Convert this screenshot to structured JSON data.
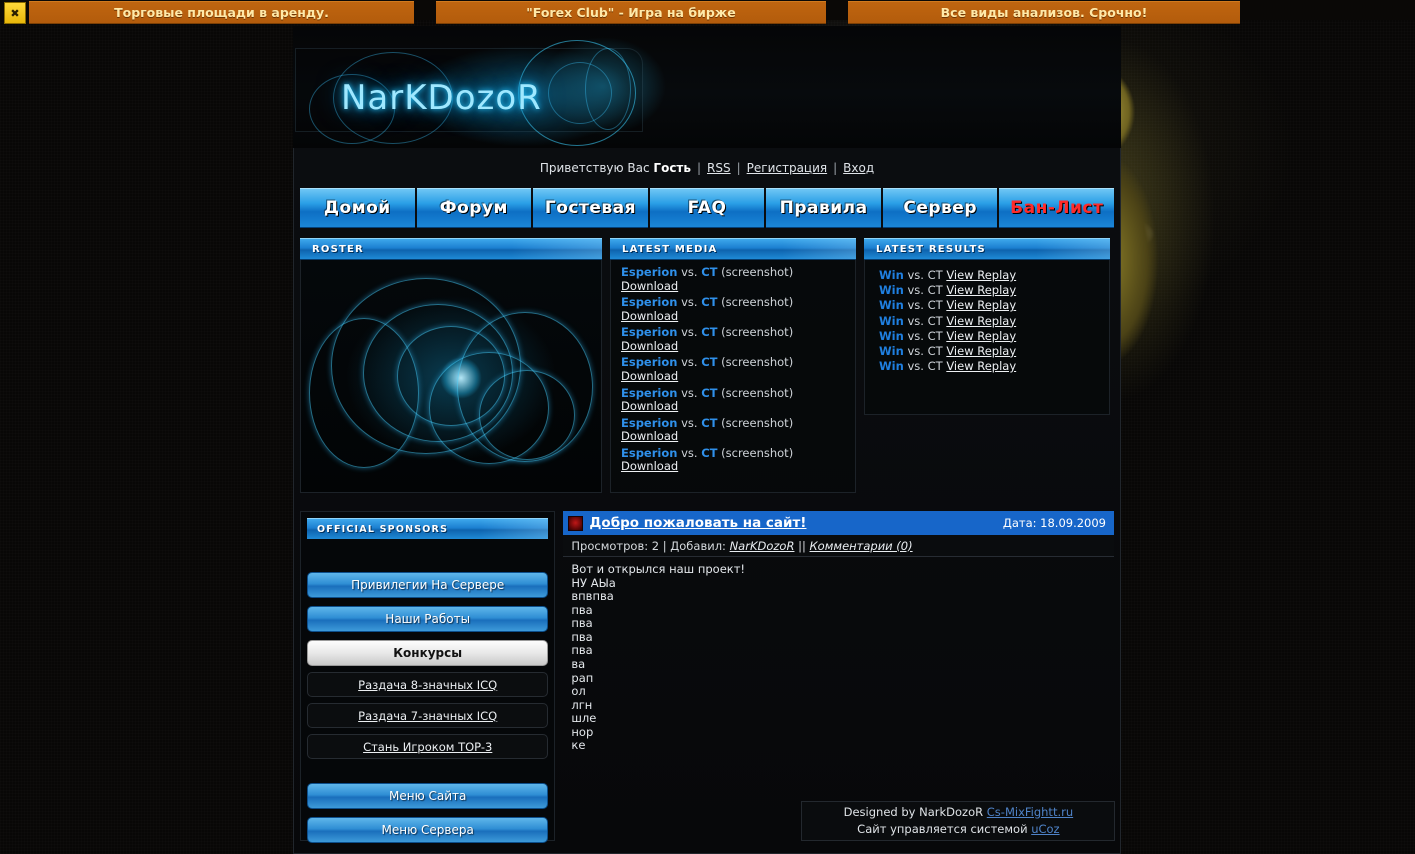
{
  "ads": {
    "close_icon": "close-icon",
    "items": [
      "Торговые площади в аренду.",
      "\"Forex Club\" - Игра на бирже",
      "Все виды анализов. Срочно!"
    ]
  },
  "header": {
    "logo": "NarKDozoR"
  },
  "greeting": {
    "prefix": "Приветствую Вас",
    "user": "Гость",
    "links": [
      "RSS",
      "Регистрация",
      "Вход"
    ]
  },
  "nav": {
    "items": [
      {
        "label": "Домой",
        "danger": false
      },
      {
        "label": "Форум",
        "danger": false
      },
      {
        "label": "Гостевая",
        "danger": false
      },
      {
        "label": "FAQ",
        "danger": false
      },
      {
        "label": "Правила",
        "danger": false
      },
      {
        "label": "Сервер",
        "danger": false
      },
      {
        "label": "Бан-Лист",
        "danger": true
      }
    ]
  },
  "boxes": {
    "roster": {
      "title": "ROSTER"
    },
    "media": {
      "title": "LATEST MEDIA",
      "rows": [
        {
          "team": "Esperion",
          "vs": "vs.",
          "opponent": "CT",
          "kind": "(screenshot)",
          "download": "Download"
        },
        {
          "team": "Esperion",
          "vs": "vs.",
          "opponent": "CT",
          "kind": "(screenshot)",
          "download": "Download"
        },
        {
          "team": "Esperion",
          "vs": "vs.",
          "opponent": "CT",
          "kind": "(screenshot)",
          "download": "Download"
        },
        {
          "team": "Esperion",
          "vs": "vs.",
          "opponent": "CT",
          "kind": "(screenshot)",
          "download": "Download"
        },
        {
          "team": "Esperion",
          "vs": "vs.",
          "opponent": "CT",
          "kind": "(screenshot)",
          "download": "Download"
        },
        {
          "team": "Esperion",
          "vs": "vs.",
          "opponent": "CT",
          "kind": "(screenshot)",
          "download": "Download"
        },
        {
          "team": "Esperion",
          "vs": "vs.",
          "opponent": "CT",
          "kind": "(screenshot)",
          "download": "Download"
        }
      ]
    },
    "results": {
      "title": "LATEST RESULTS",
      "rows": [
        {
          "result": "Win",
          "vs": "vs.",
          "opponent": "CT",
          "link": "View Replay"
        },
        {
          "result": "Win",
          "vs": "vs.",
          "opponent": "CT",
          "link": "View Replay"
        },
        {
          "result": "Win",
          "vs": "vs.",
          "opponent": "CT",
          "link": "View Replay"
        },
        {
          "result": "Win",
          "vs": "vs.",
          "opponent": "CT",
          "link": "View Replay"
        },
        {
          "result": "Win",
          "vs": "vs.",
          "opponent": "CT",
          "link": "View Replay"
        },
        {
          "result": "Win",
          "vs": "vs.",
          "opponent": "CT",
          "link": "View Replay"
        },
        {
          "result": "Win",
          "vs": "vs.",
          "opponent": "CT",
          "link": "View Replay"
        }
      ]
    }
  },
  "sidebar": {
    "title": "OFFICIAL SPONSORS",
    "buttons": [
      {
        "label": "Привилегии На Сервере",
        "active": false
      },
      {
        "label": "Наши Работы",
        "active": false
      },
      {
        "label": "Конкурсы",
        "active": true
      }
    ],
    "links": [
      "Раздача 8-значных ICQ",
      "Раздача 7-значных ICQ",
      "Стань Игроком TOP-3"
    ],
    "menus": [
      {
        "label": "Меню Сайта"
      },
      {
        "label": "Меню Сервера"
      }
    ]
  },
  "article": {
    "icon": "news-icon",
    "title": "Добро пожаловать на сайт!",
    "date": "Дата: 18.09.2009",
    "meta_views_label": "Просмотров:",
    "meta_views": "2",
    "meta_added_label": "Добавил:",
    "meta_author": "NarKDozoR",
    "meta_comments": "Комментарии (0)",
    "body": [
      "Вот и открылся наш проект!",
      "НУ АЫа",
      "впвпва",
      "пва",
      "пва",
      "пва",
      "пва",
      "ва",
      "рап",
      "ол",
      "лгн",
      "шле",
      "нор",
      "ке"
    ]
  },
  "footer": {
    "line1_prefix": "Designed by NarkDozoR",
    "line1_link": "Cs-MixFightt.ru",
    "line2_prefix": "Сайт управляется системой",
    "line2_link": "uCoz"
  },
  "colors": {
    "ad_bg": "#bf6510",
    "nav_blue": "#1b86d8",
    "accent_blue": "#2f90ea",
    "danger_red": "#ff2b2b",
    "logo_cyan": "#9fe8ff"
  }
}
